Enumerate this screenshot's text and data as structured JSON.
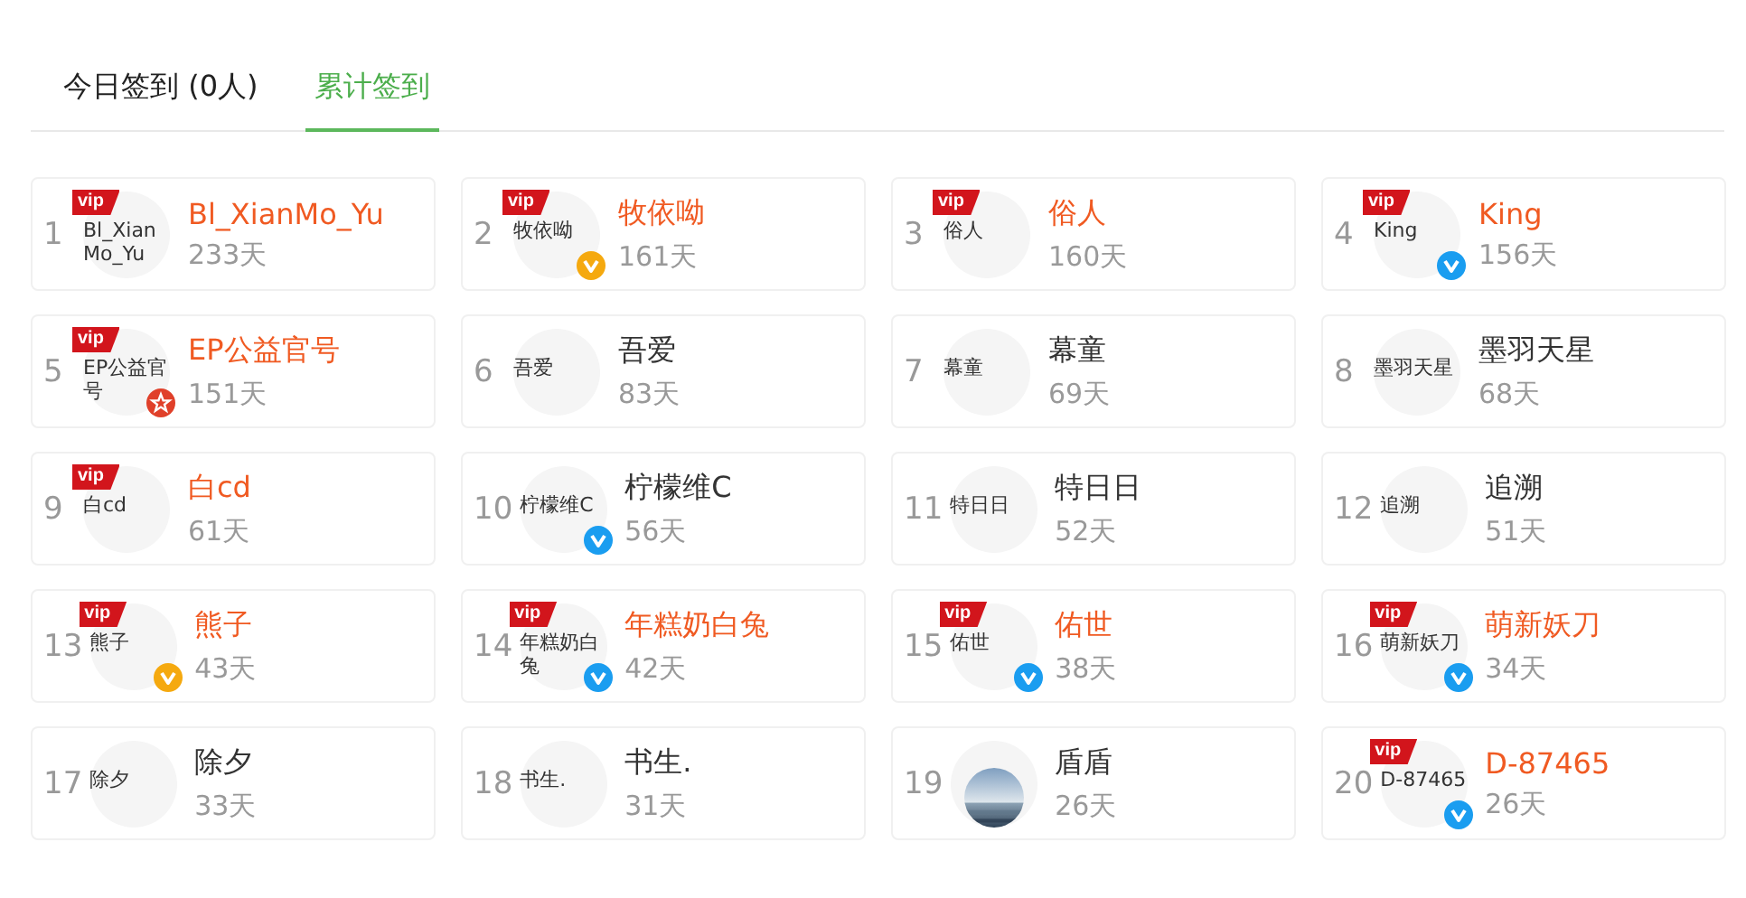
{
  "tabs": [
    {
      "label": "今日签到 (0人)",
      "selected": false
    },
    {
      "label": "累计签到",
      "selected": true
    }
  ],
  "users": [
    {
      "rank": "1",
      "avatar": {
        "kind": "text",
        "text": "Bl_XianMo_Yu"
      },
      "vip_tag": "vip",
      "name": "Bl_XianMo_Yu",
      "days": "233天"
    },
    {
      "rank": "2",
      "avatar": {
        "kind": "text",
        "text": "牧依呦"
      },
      "vip_tag": "vip",
      "badge": {
        "kind": "verified",
        "color": "#f5a90f"
      },
      "name": "牧依呦",
      "days": "161天"
    },
    {
      "rank": "3",
      "avatar": {
        "kind": "text",
        "text": "俗人"
      },
      "vip_tag": "vip",
      "name": "俗人",
      "days": "160天"
    },
    {
      "rank": "4",
      "avatar": {
        "kind": "text",
        "text": "King"
      },
      "vip_tag": "vip",
      "badge": {
        "kind": "verified",
        "color": "#1a9df0"
      },
      "name": "King",
      "days": "156天"
    },
    {
      "rank": "5",
      "avatar": {
        "kind": "text",
        "text": "EP公益官号"
      },
      "vip_tag": "vip",
      "badge": {
        "kind": "star",
        "color": "#e0402a"
      },
      "name": "EP公益官号",
      "days": "151天"
    },
    {
      "rank": "6",
      "avatar": {
        "kind": "text",
        "text": "吾爱"
      },
      "name": "吾爱",
      "days": "83天"
    },
    {
      "rank": "7",
      "avatar": {
        "kind": "text",
        "text": "幕童"
      },
      "name": "幕童",
      "days": "69天"
    },
    {
      "rank": "8",
      "avatar": {
        "kind": "text",
        "text": "墨羽天星"
      },
      "name": "墨羽天星",
      "days": "68天"
    },
    {
      "rank": "9",
      "avatar": {
        "kind": "text",
        "text": "白cd"
      },
      "vip_tag": "vip",
      "name": "白cd",
      "days": "61天"
    },
    {
      "rank": "10",
      "avatar": {
        "kind": "text",
        "text": "柠檬维C"
      },
      "badge": {
        "kind": "verified",
        "color": "#1a9df0"
      },
      "name": "柠檬维C",
      "days": "56天"
    },
    {
      "rank": "11",
      "avatar": {
        "kind": "text",
        "text": "特日日"
      },
      "name": "特日日",
      "days": "52天"
    },
    {
      "rank": "12",
      "avatar": {
        "kind": "text",
        "text": "追溯"
      },
      "name": "追溯",
      "days": "51天"
    },
    {
      "rank": "13",
      "avatar": {
        "kind": "text",
        "text": "熊子"
      },
      "vip_tag": "vip",
      "badge": {
        "kind": "verified",
        "color": "#f5a90f"
      },
      "name": "熊子",
      "days": "43天"
    },
    {
      "rank": "14",
      "avatar": {
        "kind": "text",
        "text": "年糕奶白兔"
      },
      "vip_tag": "vip",
      "badge": {
        "kind": "verified",
        "color": "#1a9df0"
      },
      "name": "年糕奶白兔",
      "days": "42天"
    },
    {
      "rank": "15",
      "avatar": {
        "kind": "text",
        "text": "佑世"
      },
      "vip_tag": "vip",
      "badge": {
        "kind": "verified",
        "color": "#1a9df0"
      },
      "name": "佑世",
      "days": "38天"
    },
    {
      "rank": "16",
      "avatar": {
        "kind": "text",
        "text": "萌新妖刀"
      },
      "vip_tag": "vip",
      "badge": {
        "kind": "verified",
        "color": "#1a9df0"
      },
      "name": "萌新妖刀",
      "days": "34天"
    },
    {
      "rank": "17",
      "avatar": {
        "kind": "text",
        "text": "除夕"
      },
      "name": "除夕",
      "days": "33天"
    },
    {
      "rank": "18",
      "avatar": {
        "kind": "text",
        "text": "书生."
      },
      "name": "书生.",
      "days": "31天"
    },
    {
      "rank": "19",
      "name": "盾盾",
      "days": "26天"
    },
    {
      "rank": "20",
      "avatar": {
        "kind": "text",
        "text": "D-87465"
      },
      "vip_tag": "vip",
      "badge": {
        "kind": "verified",
        "color": "#1a9df0"
      },
      "name": "D-87465",
      "days": "26天"
    }
  ]
}
